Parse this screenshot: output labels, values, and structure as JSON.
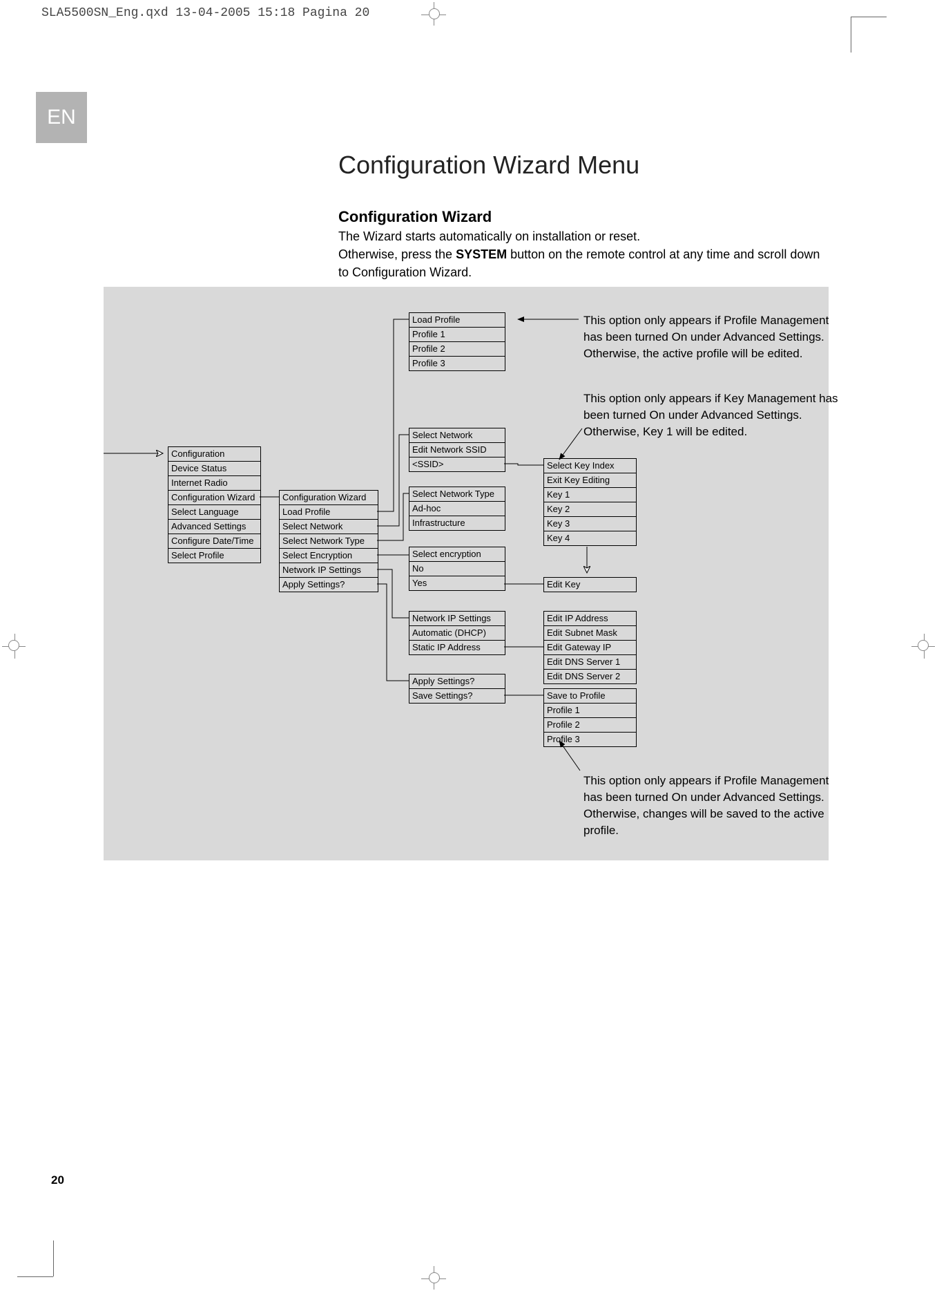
{
  "header_line": "SLA5500SN_Eng.qxd  13-04-2005  15:18  Pagina 20",
  "lang_tab": "EN",
  "title": "Configuration Wizard Menu",
  "subtitle": "Configuration Wizard",
  "body_l1": "The Wizard starts automatically on installation or reset.",
  "body_l2a": "Otherwise, press the ",
  "body_l2b": "SYSTEM",
  "body_l2c": " button on the remote control at any time and scroll down to Configuration Wizard.",
  "note1": "This option only appears if Profile Management has been turned On under Advanced Settings. Otherwise, the active profile will be edited.",
  "note2": "This option only appears if Key Management has been turned On under Advanced Settings.\nOtherwise, Key 1 will be edited.",
  "note3": "This option only appears if Profile Management has been turned On under Advanced Settings. Otherwise, changes will be saved to the active profile.",
  "page_num": "20",
  "col1": [
    "Configuration",
    "Device Status",
    "Internet Radio",
    "Configuration Wizard",
    "Select Language",
    "Advanced Settings",
    "Configure Date/Time",
    "Select Profile"
  ],
  "col2": [
    "Configuration Wizard",
    "Load Profile",
    "Select Network",
    "Select Network Type",
    "Select Encryption",
    "Network IP Settings",
    "Apply Settings?"
  ],
  "g_load": [
    "Load Profile",
    "Profile 1",
    "Profile 2",
    "Profile 3"
  ],
  "g_selnet": [
    "Select Network",
    "Edit Network SSID",
    "<SSID>"
  ],
  "g_nettype": [
    "Select Network Type",
    "Ad-hoc",
    "Infrastructure"
  ],
  "g_enc": [
    "Select encryption",
    "No",
    "Yes"
  ],
  "g_ip": [
    "Network IP Settings",
    "Automatic (DHCP)",
    "Static IP Address"
  ],
  "g_apply": [
    "Apply Settings?",
    "Save Settings?"
  ],
  "g_key": [
    "Select Key Index",
    "Exit Key Editing",
    "Key 1",
    "Key 2",
    "Key 3",
    "Key 4"
  ],
  "g_editkey": [
    "Edit Key"
  ],
  "g_editip": [
    "Edit IP Address",
    "Edit Subnet Mask",
    "Edit Gateway IP",
    "Edit DNS Server 1",
    "Edit DNS Server 2"
  ],
  "g_save": [
    "Save to Profile",
    "Profile 1",
    "Profile 2",
    "Profile 3"
  ]
}
